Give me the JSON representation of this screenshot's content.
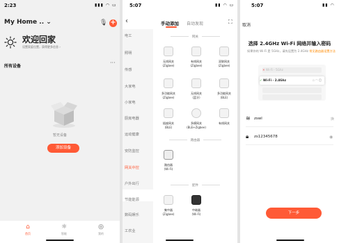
{
  "colors": {
    "accent": "#ff5a36",
    "link": "#ff8a00"
  },
  "screen1": {
    "time": "2:23",
    "home_title": "My Home .. ⌄",
    "welcome": "欢迎回家",
    "welcome_hint": "设置家庭位置，获得更多信息 ›",
    "all_devices": "所有设备",
    "more": "···",
    "no_devices": "暂无设备",
    "add_device_button": "添加设备",
    "tabs": [
      {
        "label": "首页"
      },
      {
        "label": "智能"
      },
      {
        "label": "我的"
      }
    ]
  },
  "screen2": {
    "time": "5:07",
    "tab_manual": "手动添加",
    "tab_auto": "自动发现",
    "categories": [
      "电工",
      "照明",
      "传感",
      "大家电",
      "小家电",
      "厨房电器",
      "运动健康",
      "安防监控",
      "网关中控",
      "户外出行",
      "节能能源",
      "数码娱乐",
      "工农业"
    ],
    "active_category": "网关中控",
    "sections": {
      "gateway": "网关",
      "router": "路由器",
      "accessory": "配件"
    },
    "gateway_devices": [
      {
        "label": "无线网关\n(Zigbee)"
      },
      {
        "label": "有线网关\n(Zigbee)"
      },
      {
        "label": "双联网关\n(Zigbee)"
      },
      {
        "label": "多功能网关\n(Zigbee)"
      },
      {
        "label": "无线网关\n(蓝牙)"
      },
      {
        "label": "多功能网关\n(BLE)"
      },
      {
        "label": "插座网关\n(BLE)"
      },
      {
        "label": "多模网关\n(BLE+Zigbee)"
      },
      {
        "label": "有线网关"
      }
    ],
    "router_devices": [
      {
        "label": "路由器\n(Wi-Fi)"
      }
    ],
    "accessory_devices": [
      {
        "label": "集中器\n(Zigbee)"
      },
      {
        "label": "中继器\n(Wi-Fi)"
      }
    ]
  },
  "screen3": {
    "time": "5:07",
    "cancel": "取消",
    "title": "选择 2.4GHz Wi-Fi 网络并输入密码",
    "desc_prefix": "如果你的 Wi-Fi 是 5GHz，请先设置为 2.4GHz",
    "desc_link": "常见路由器设置方法",
    "illustration_5g": "Wi-Fi - 5Ghz",
    "illustration_24g": "Wi-Fi - 2.4Ghz",
    "ssid_value": "zswl",
    "password_value": "zs12345678",
    "ssid_action": "换",
    "next_button": "下一步"
  }
}
